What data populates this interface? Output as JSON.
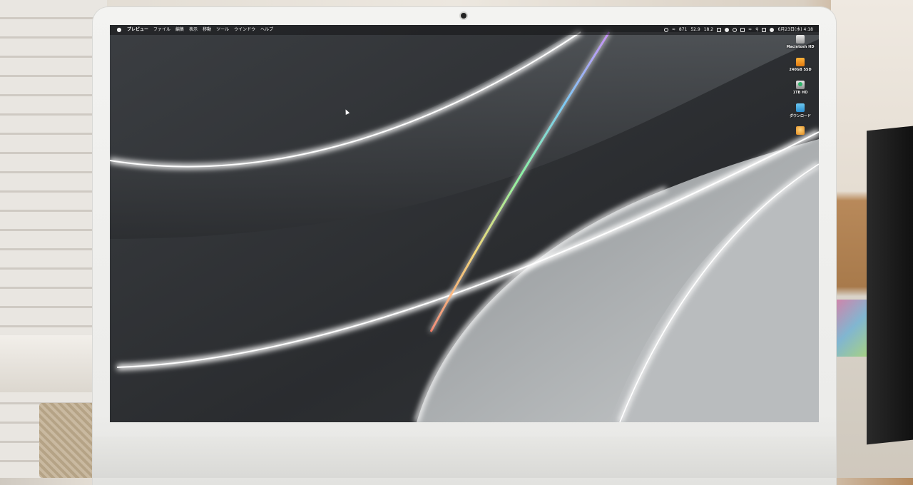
{
  "menubar": {
    "apple_icon": "apple-icon",
    "app_name": "プレビュー",
    "items": [
      "ファイル",
      "編集",
      "表示",
      "移動",
      "ツール",
      "ウインドウ",
      "ヘルプ"
    ],
    "status": {
      "network_1": "871",
      "cpu": "52.9",
      "temp": "18.2",
      "datetime": "6月23日(水) 4:18"
    }
  },
  "desktop": {
    "icons": [
      {
        "label": "Macintosh HD",
        "icon": "hard-drive-icon"
      },
      {
        "label": "240GB SSD",
        "icon": "external-drive-icon"
      },
      {
        "label": "1TB HD",
        "icon": "time-machine-drive-icon"
      },
      {
        "label": "ダウンロード",
        "icon": "downloads-folder-icon"
      },
      {
        "label": "",
        "icon": "app-icon"
      }
    ]
  },
  "colors": {
    "menubar": "#141416",
    "wallpaper_dark": "#2a2c2f",
    "wallpaper_light": "#c7cacb",
    "drive_orange": "#e07a10",
    "folder_blue": "#2d8fd0",
    "imac_silver": "#ececea"
  }
}
